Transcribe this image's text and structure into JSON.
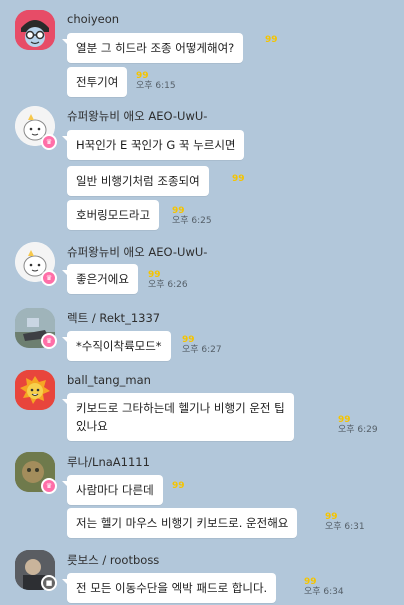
{
  "messages": [
    {
      "sender": "choiyeon",
      "bubbles": [
        {
          "text": "열분 그 히드라 조종 어떻게해여?",
          "count": "99",
          "time": ""
        },
        {
          "text": "전투기여",
          "count": "99",
          "time": "오후 6:15"
        }
      ]
    },
    {
      "sender": "슈퍼왕뉴비 애오 AEO-UwU-",
      "bubbles": [
        {
          "text": "H꾹인가 E 꾹인가 G 꾹 누르시면",
          "count": "",
          "time": ""
        },
        {
          "text": "일반 비행기처럼 조종되여",
          "count": "99",
          "time": ""
        },
        {
          "text": "호버링모드라고",
          "count": "99",
          "time": "오후 6:25"
        }
      ]
    },
    {
      "sender": "슈퍼왕뉴비 애오 AEO-UwU-",
      "bubbles": [
        {
          "text": "좋은거에요",
          "count": "99",
          "time": "오후 6:26"
        }
      ]
    },
    {
      "sender": "렉트 / Rekt_1337",
      "bubbles": [
        {
          "text": "*수직이착륙모드*",
          "count": "99",
          "time": "오후 6:27"
        }
      ]
    },
    {
      "sender": "ball_tang_man",
      "bubbles": [
        {
          "text": "키보드로 그타하는데 헬기나 비행기 운전 팁\n있나요",
          "count": "99",
          "time": "오후 6:29"
        }
      ]
    },
    {
      "sender": "루나/LnaA1111",
      "bubbles": [
        {
          "text": "사람마다 다른데",
          "count": "99",
          "time": ""
        },
        {
          "text": "저는 헬기 마우스 비행기 키보드로. 운전해요",
          "count": "99",
          "time": "오후 6:31"
        }
      ]
    },
    {
      "sender": "릇보스 / rootboss",
      "bubbles": [
        {
          "text": "전 모든 이동수단을 엑박 패드로 합니다.",
          "count": "99",
          "time": "오후 6:34"
        }
      ]
    }
  ]
}
